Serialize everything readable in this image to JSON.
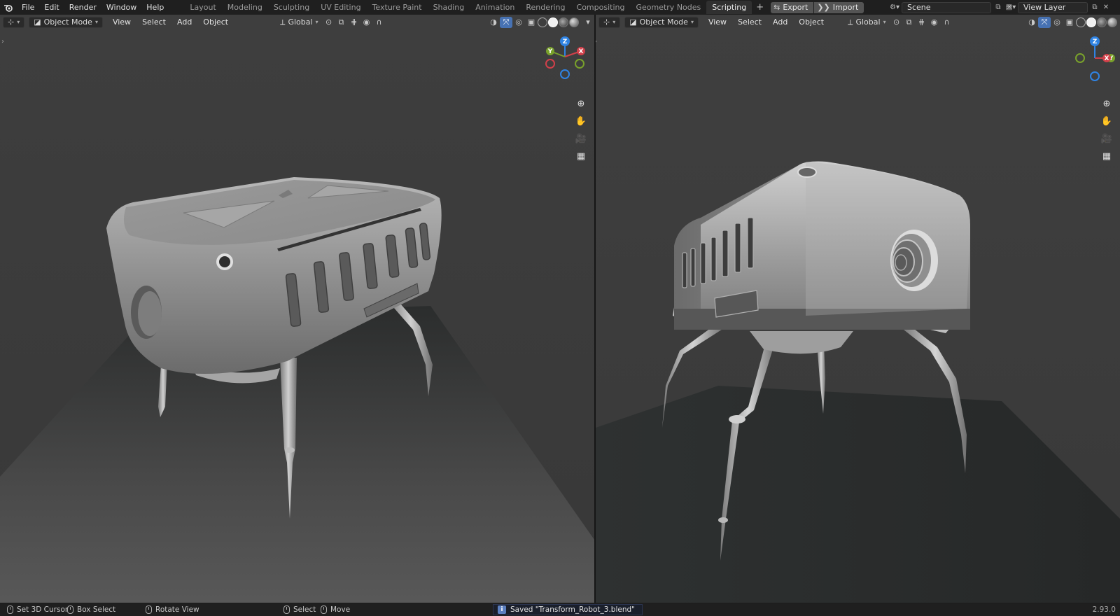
{
  "topbar": {
    "menus": [
      "File",
      "Edit",
      "Render",
      "Window",
      "Help"
    ],
    "workspaces": [
      "Layout",
      "Modeling",
      "Sculpting",
      "UV Editing",
      "Texture Paint",
      "Shading",
      "Animation",
      "Rendering",
      "Compositing",
      "Geometry Nodes",
      "Scripting"
    ],
    "active_workspace": "Scripting",
    "export_label": "Export",
    "import_label": "Import",
    "scene_name": "Scene",
    "view_layer": "View Layer"
  },
  "viewport_left": {
    "mode": "Object Mode",
    "menus": [
      "View",
      "Select",
      "Add",
      "Object"
    ],
    "transform_orientation": "Global"
  },
  "viewport_right": {
    "mode": "Object Mode",
    "menus": [
      "View",
      "Select",
      "Add",
      "Object"
    ],
    "transform_orientation": "Global"
  },
  "gizmo_left": {
    "z": "Z",
    "y": "Y",
    "x": "X"
  },
  "gizmo_right": {
    "z": "Z",
    "y": "Y",
    "x": "X"
  },
  "statusbar": {
    "set_cursor": "Set 3D Cursor",
    "box_select": "Box Select",
    "rotate_view": "Rotate View",
    "select": "Select",
    "move": "Move",
    "saved_message": "Saved \"Transform_Robot_3.blend\"",
    "version": "2.93.0"
  },
  "colors": {
    "accent": "#4772b3",
    "axis_x": "#d1404a",
    "axis_y": "#79a12b",
    "axis_z": "#2f83e3"
  }
}
